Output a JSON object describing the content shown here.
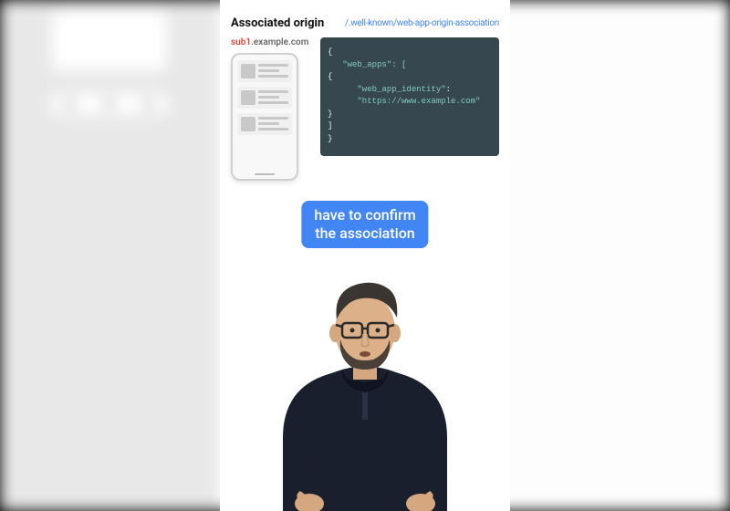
{
  "heading": "Associated origin",
  "well_known_path": "/.well-known/web-app-origin-association",
  "subdomain": {
    "sub": "sub1",
    "domain": ".example.com"
  },
  "code": {
    "l1": "{",
    "l2": "  \"web_apps\": [",
    "l3": "    {",
    "l4": "      \"web_app_identity\":",
    "l5": "      \"https://www.example.com\"",
    "l6": "    }",
    "l7": "  ]",
    "l8": "}"
  },
  "caption": {
    "line1": "have to confirm",
    "line2": "the association"
  }
}
